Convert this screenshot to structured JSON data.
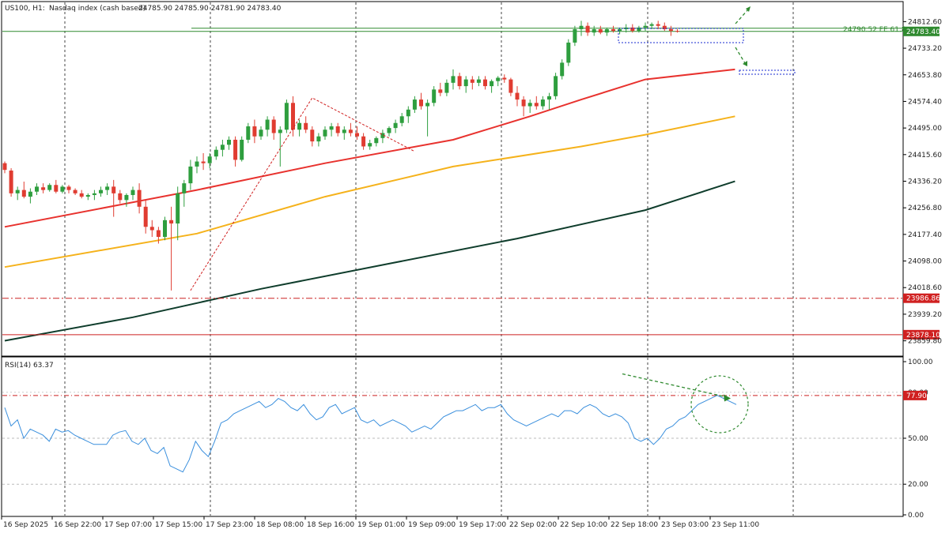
{
  "header": {
    "symbol": "US100, H1:",
    "description": "Nasdaq index (cash based)",
    "ohlc": "24785.90 24785.90 24781.90 24783.40"
  },
  "main_yaxis_labels": [
    "24812.60",
    "24733.20",
    "24653.80",
    "24574.40",
    "24495.00",
    "24415.60",
    "24336.20",
    "24256.80",
    "24177.40",
    "24098.00",
    "24018.60",
    "23939.20",
    "23859.80"
  ],
  "price_tags": {
    "current": "24783.40",
    "support_1": "23986.86",
    "support_2": "23878.10",
    "fe_label": "24790.52 FE 61.8"
  },
  "rsi": {
    "header": "RSI(14) 63.37",
    "axis_labels": [
      "100.00",
      "80.00",
      "50.00",
      "20.00",
      "0.00"
    ],
    "level_tag": "77.90"
  },
  "x_labels": [
    "16 Sep 2025",
    "16 Sep 22:00",
    "17 Sep 07:00",
    "17 Sep 15:00",
    "17 Sep 23:00",
    "18 Sep 08:00",
    "18 Sep 16:00",
    "19 Sep 01:00",
    "19 Sep 09:00",
    "19 Sep 17:00",
    "22 Sep 02:00",
    "22 Sep 10:00",
    "22 Sep 18:00",
    "23 Sep 03:00",
    "23 Sep 11:00"
  ],
  "colors": {
    "bull": "#2e9e3e",
    "bear": "#e03c31",
    "ma_fast": "#e8322e",
    "ma_mid": "#f5b21b",
    "ma_slow": "#0f3d2c",
    "rsi_line": "#3a8fdd",
    "annotation_green": "#2f8a2f"
  },
  "chart_data": {
    "type": "candlestick",
    "timeframe": "H1",
    "ylim": [
      23840,
      24830
    ],
    "candles": [
      [
        24390,
        24395,
        24360,
        24370
      ],
      [
        24368,
        24375,
        24290,
        24300
      ],
      [
        24300,
        24320,
        24280,
        24310
      ],
      [
        24310,
        24335,
        24285,
        24290
      ],
      [
        24290,
        24315,
        24270,
        24305
      ],
      [
        24305,
        24330,
        24295,
        24320
      ],
      [
        24318,
        24330,
        24300,
        24310
      ],
      [
        24310,
        24330,
        24305,
        24325
      ],
      [
        24325,
        24340,
        24300,
        24305
      ],
      [
        24305,
        24325,
        24300,
        24320
      ],
      [
        24320,
        24325,
        24300,
        24310
      ],
      [
        24310,
        24315,
        24295,
        24300
      ],
      [
        24300,
        24310,
        24285,
        24290
      ],
      [
        24290,
        24300,
        24280,
        24295
      ],
      [
        24295,
        24310,
        24280,
        24300
      ],
      [
        24300,
        24320,
        24290,
        24310
      ],
      [
        24310,
        24330,
        24295,
        24320
      ],
      [
        24320,
        24340,
        24230,
        24300
      ],
      [
        24300,
        24310,
        24270,
        24280
      ],
      [
        24280,
        24300,
        24260,
        24295
      ],
      [
        24295,
        24320,
        24280,
        24310
      ],
      [
        24310,
        24330,
        24240,
        24260
      ],
      [
        24260,
        24280,
        24180,
        24200
      ],
      [
        24200,
        24220,
        24170,
        24190
      ],
      [
        24190,
        24200,
        24150,
        24170
      ],
      [
        24170,
        24230,
        24160,
        24220
      ],
      [
        24220,
        24260,
        24010,
        24210
      ],
      [
        24210,
        24320,
        24160,
        24300
      ],
      [
        24300,
        24340,
        24260,
        24330
      ],
      [
        24330,
        24400,
        24310,
        24380
      ],
      [
        24380,
        24410,
        24360,
        24395
      ],
      [
        24395,
        24420,
        24370,
        24390
      ],
      [
        24390,
        24420,
        24375,
        24410
      ],
      [
        24410,
        24440,
        24400,
        24430
      ],
      [
        24430,
        24460,
        24410,
        24445
      ],
      [
        24445,
        24470,
        24430,
        24460
      ],
      [
        24460,
        24470,
        24380,
        24400
      ],
      [
        24400,
        24470,
        24395,
        24460
      ],
      [
        24460,
        24510,
        24450,
        24500
      ],
      [
        24500,
        24520,
        24450,
        24470
      ],
      [
        24470,
        24500,
        24460,
        24490
      ],
      [
        24490,
        24530,
        24470,
        24520
      ],
      [
        24520,
        24530,
        24460,
        24480
      ],
      [
        24480,
        24500,
        24380,
        24490
      ],
      [
        24490,
        24580,
        24480,
        24570
      ],
      [
        24570,
        24590,
        24470,
        24490
      ],
      [
        24490,
        24520,
        24470,
        24510
      ],
      [
        24510,
        24530,
        24480,
        24490
      ],
      [
        24490,
        24500,
        24440,
        24455
      ],
      [
        24455,
        24480,
        24440,
        24470
      ],
      [
        24470,
        24500,
        24460,
        24490
      ],
      [
        24490,
        24510,
        24470,
        24500
      ],
      [
        24500,
        24510,
        24470,
        24480
      ],
      [
        24480,
        24500,
        24460,
        24490
      ],
      [
        24490,
        24510,
        24470,
        24480
      ],
      [
        24480,
        24500,
        24460,
        24470
      ],
      [
        24470,
        24480,
        24430,
        24440
      ],
      [
        24440,
        24460,
        24430,
        24450
      ],
      [
        24450,
        24470,
        24440,
        24465
      ],
      [
        24465,
        24490,
        24450,
        24480
      ],
      [
        24480,
        24500,
        24470,
        24495
      ],
      [
        24495,
        24520,
        24480,
        24510
      ],
      [
        24510,
        24540,
        24500,
        24530
      ],
      [
        24530,
        24560,
        24510,
        24550
      ],
      [
        24550,
        24590,
        24540,
        24580
      ],
      [
        24580,
        24600,
        24550,
        24560
      ],
      [
        24560,
        24580,
        24470,
        24570
      ],
      [
        24570,
        24620,
        24560,
        24610
      ],
      [
        24610,
        24630,
        24590,
        24600
      ],
      [
        24600,
        24640,
        24590,
        24630
      ],
      [
        24630,
        24670,
        24610,
        24650
      ],
      [
        24650,
        24660,
        24610,
        24620
      ],
      [
        24620,
        24650,
        24600,
        24640
      ],
      [
        24640,
        24650,
        24610,
        24630
      ],
      [
        24630,
        24650,
        24620,
        24640
      ],
      [
        24640,
        24650,
        24610,
        24620
      ],
      [
        24620,
        24640,
        24600,
        24635
      ],
      [
        24635,
        24650,
        24620,
        24645
      ],
      [
        24645,
        24655,
        24630,
        24640
      ],
      [
        24640,
        24645,
        24590,
        24600
      ],
      [
        24600,
        24620,
        24560,
        24580
      ],
      [
        24580,
        24590,
        24530,
        24560
      ],
      [
        24560,
        24580,
        24540,
        24570
      ],
      [
        24570,
        24590,
        24550,
        24560
      ],
      [
        24560,
        24590,
        24550,
        24580
      ],
      [
        24580,
        24600,
        24550,
        24590
      ],
      [
        24590,
        24660,
        24580,
        24650
      ],
      [
        24650,
        24700,
        24640,
        24690
      ],
      [
        24690,
        24760,
        24680,
        24750
      ],
      [
        24750,
        24800,
        24740,
        24790
      ],
      [
        24790,
        24815,
        24770,
        24800
      ],
      [
        24800,
        24810,
        24770,
        24780
      ],
      [
        24780,
        24800,
        24770,
        24790
      ],
      [
        24790,
        24800,
        24775,
        24780
      ],
      [
        24780,
        24795,
        24770,
        24790
      ],
      [
        24790,
        24800,
        24780,
        24785
      ],
      [
        24785,
        24795,
        24775,
        24790
      ],
      [
        24790,
        24805,
        24780,
        24795
      ],
      [
        24795,
        24805,
        24780,
        24785
      ],
      [
        24785,
        24800,
        24780,
        24795
      ],
      [
        24795,
        24810,
        24785,
        24800
      ],
      [
        24800,
        24810,
        24790,
        24805
      ],
      [
        24805,
        24815,
        24790,
        24800
      ],
      [
        24800,
        24810,
        24785,
        24790
      ],
      [
        24790,
        24800,
        24770,
        24785
      ],
      [
        24785,
        24790,
        24780,
        24783
      ]
    ],
    "ma_fast": [
      [
        0,
        24200
      ],
      [
        30,
        24310
      ],
      [
        50,
        24390
      ],
      [
        70,
        24460
      ],
      [
        82,
        24530
      ],
      [
        90,
        24580
      ],
      [
        100,
        24640
      ],
      [
        114,
        24670
      ]
    ],
    "ma_mid": [
      [
        0,
        24080
      ],
      [
        30,
        24180
      ],
      [
        50,
        24290
      ],
      [
        70,
        24380
      ],
      [
        90,
        24440
      ],
      [
        100,
        24475
      ],
      [
        114,
        24530
      ]
    ],
    "ma_slow": [
      [
        0,
        23860
      ],
      [
        20,
        23930
      ],
      [
        40,
        24015
      ],
      [
        60,
        24090
      ],
      [
        80,
        24165
      ],
      [
        100,
        24250
      ],
      [
        114,
        24336
      ]
    ],
    "levels": [
      {
        "name": "FE 61.8",
        "value": 24790.52,
        "color": "#2f8a2f"
      },
      {
        "name": "support_1",
        "value": 23986.86,
        "color": "#cc2222"
      },
      {
        "name": "support_2",
        "value": 23878.1,
        "color": "#cc2222"
      }
    ],
    "rsi_values": [
      70,
      58,
      62,
      50,
      56,
      54,
      52,
      48,
      56,
      54,
      55,
      52,
      50,
      48,
      46,
      46,
      46,
      52,
      54,
      55,
      48,
      46,
      50,
      42,
      40,
      44,
      32,
      30,
      28,
      36,
      48,
      42,
      38,
      48,
      60,
      62,
      66,
      68,
      70,
      72,
      74,
      70,
      72,
      76,
      74,
      70,
      68,
      72,
      66,
      62,
      64,
      70,
      72,
      66,
      68,
      70,
      62,
      60,
      62,
      58,
      60,
      62,
      60,
      58,
      54,
      56,
      58,
      56,
      60,
      64,
      66,
      68,
      68,
      70,
      72,
      68,
      70,
      70,
      72,
      66,
      62,
      60,
      58,
      60,
      62,
      64,
      66,
      64,
      68,
      68,
      66,
      70,
      72,
      70,
      66,
      64,
      66,
      64,
      60,
      50,
      48,
      50,
      46,
      50,
      56,
      58,
      62,
      64,
      68,
      72,
      74,
      76,
      78,
      76,
      74,
      72
    ]
  }
}
